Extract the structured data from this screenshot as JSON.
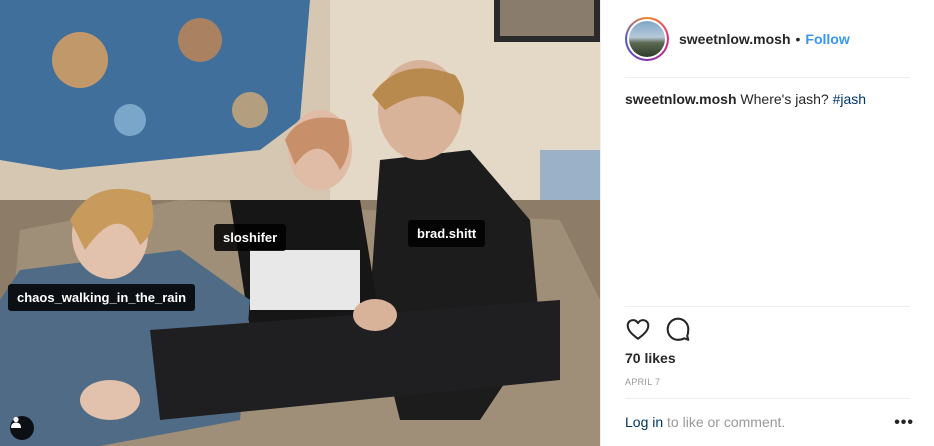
{
  "photo": {
    "tags": [
      {
        "username": "sloshifer"
      },
      {
        "username": "brad.shitt"
      },
      {
        "username": "chaos_walking_in_the_rain"
      }
    ],
    "tag_indicator_icon": "user-tag-icon"
  },
  "header": {
    "username": "sweetnlow.mosh",
    "separator": "•",
    "follow_label": "Follow"
  },
  "caption": {
    "username": "sweetnlow.mosh",
    "text": "Where's jash?",
    "hashtag": "#jash"
  },
  "actions": {
    "like_icon": "heart-icon",
    "comment_icon": "comment-icon"
  },
  "likes": "70 likes",
  "date": "APRIL 7",
  "footer": {
    "login_link": "Log in",
    "login_suffix": "to like or comment.",
    "more_label": "•••"
  },
  "colors": {
    "link_blue": "#3897f0",
    "hashtag": "#003569",
    "muted": "#999999",
    "text": "#262626"
  }
}
